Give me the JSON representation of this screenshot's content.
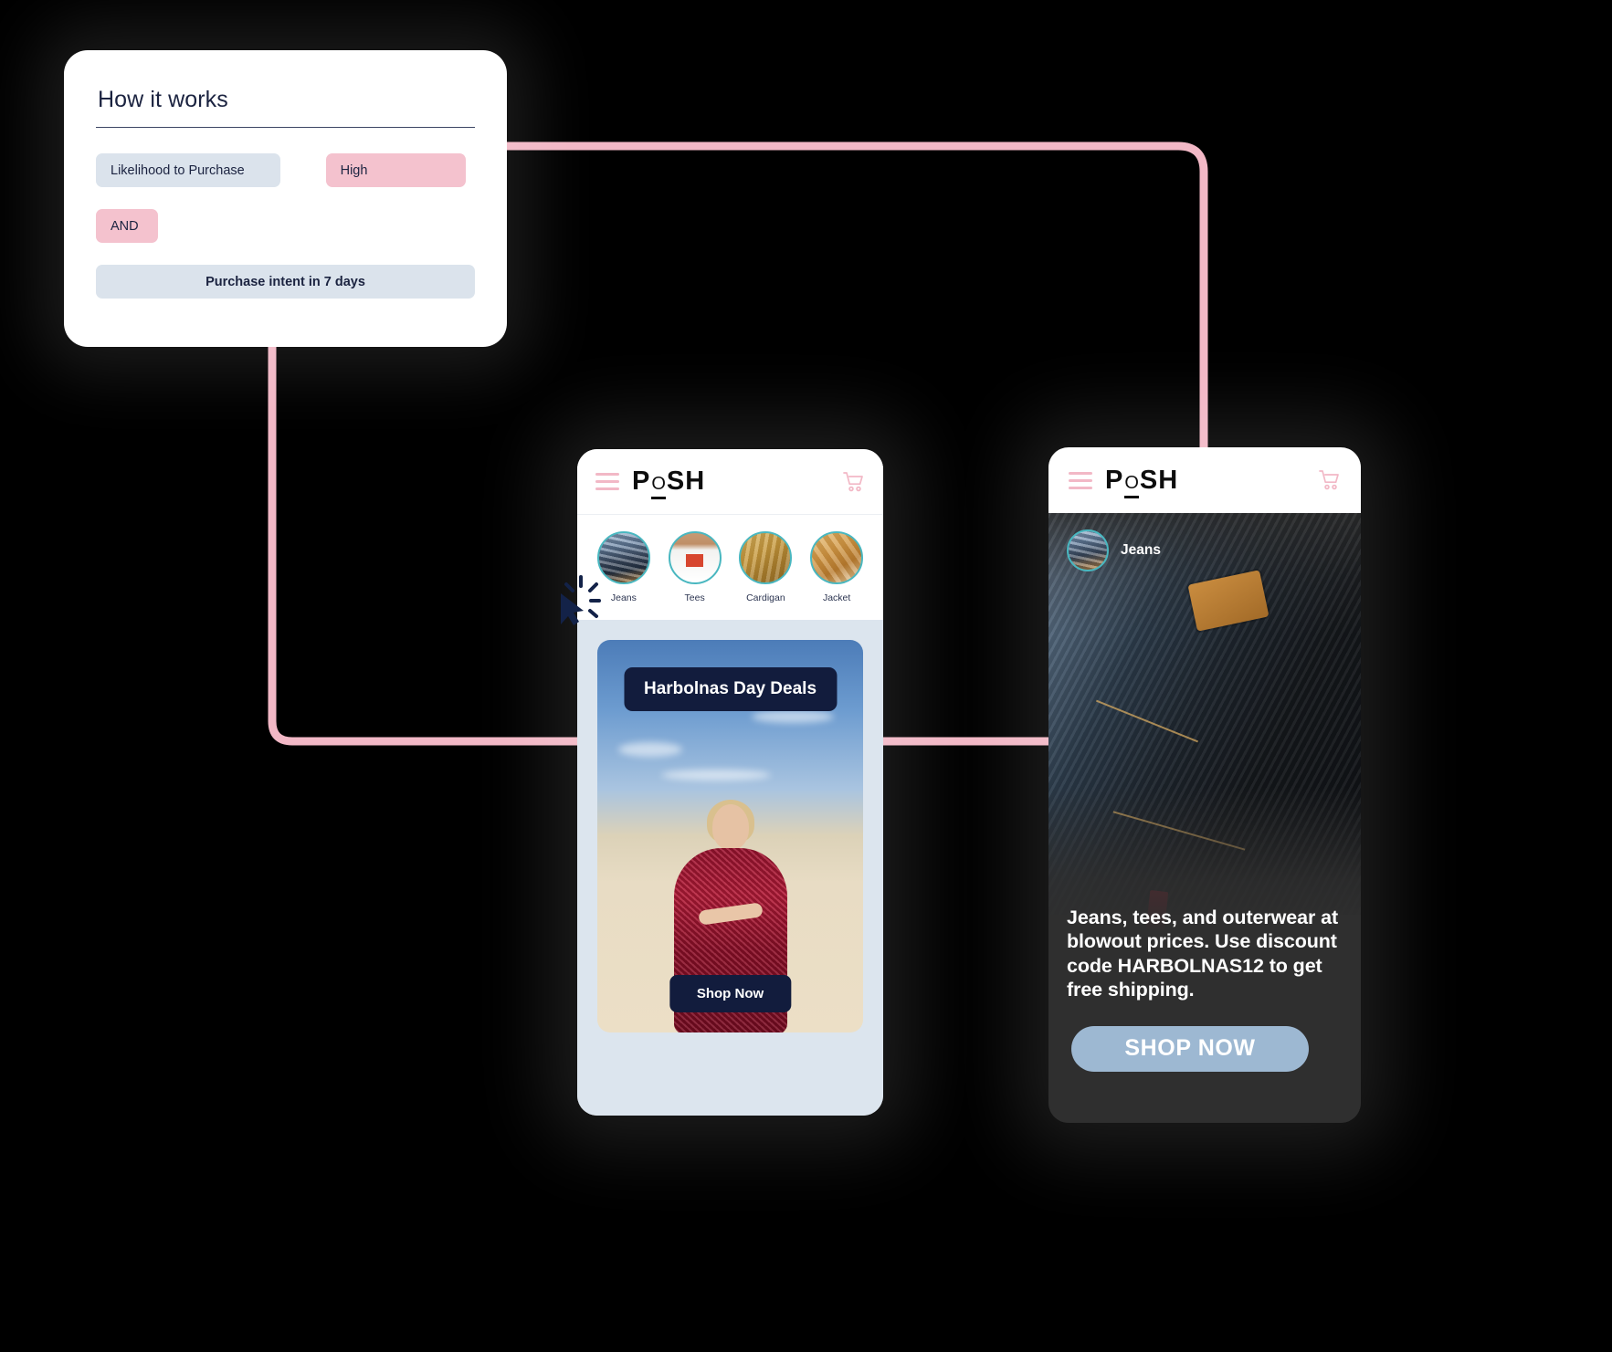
{
  "card": {
    "title": "How it works",
    "condition_label": "Likelihood to Purchase",
    "condition_value": "High",
    "operator": "AND",
    "outcome": "Purchase intent in 7 days"
  },
  "phone_a": {
    "logo": "POSH",
    "logo_parts": {
      "p": "P",
      "o": "O",
      "sh": "SH"
    },
    "menu_icon": "hamburger-menu-icon",
    "cart_icon": "shopping-cart-icon",
    "categories": [
      {
        "label": "Jeans"
      },
      {
        "label": "Tees"
      },
      {
        "label": "Cardigan"
      },
      {
        "label": "Jacket"
      }
    ],
    "banner_title": "Harbolnas Day Deals",
    "shop_button": "Shop Now"
  },
  "phone_b": {
    "logo": "POSH",
    "logo_parts": {
      "p": "P",
      "o": "O",
      "sh": "SH"
    },
    "menu_icon": "hamburger-menu-icon",
    "cart_icon": "shopping-cart-icon",
    "category_label": "Jeans",
    "description": "Jeans, tees, and outerwear at blowout prices. Use discount code HARBOLNAS12 to get free shipping.",
    "shop_button": "SHOP NOW"
  },
  "colors": {
    "background": "#000000",
    "accent_pink": "#f2b8c6",
    "chip_blue": "#dbe3ec",
    "chip_pink": "#f4c2ce",
    "navy": "#121c3d",
    "teal_ring": "#49b7c0",
    "button_blue": "#9db8d2",
    "cursor_navy": "#132248"
  }
}
